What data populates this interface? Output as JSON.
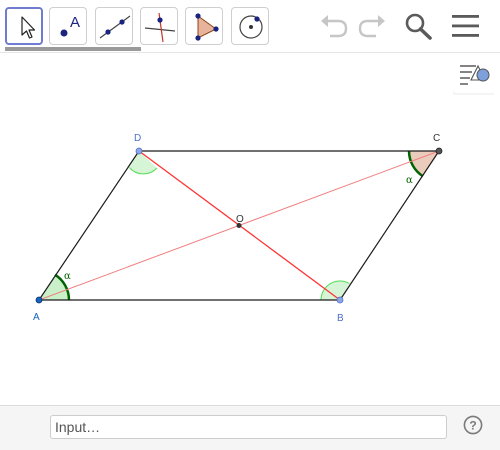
{
  "toolbar": {
    "tools": [
      {
        "name": "move-tool",
        "selected": true
      },
      {
        "name": "point-tool",
        "selected": false,
        "label": "A"
      },
      {
        "name": "line-tool",
        "selected": false
      },
      {
        "name": "perpendicular-line-tool",
        "selected": false
      },
      {
        "name": "polygon-tool",
        "selected": false
      },
      {
        "name": "circle-tool",
        "selected": false
      }
    ],
    "undo_icon": "undo-icon",
    "redo_icon": "redo-icon",
    "search_icon": "search-icon",
    "menu_icon": "hamburger-menu-icon"
  },
  "style_bar_toggle_icon": "style-bar-toggle-icon",
  "construction": {
    "points": {
      "A": {
        "label": "A",
        "color": "#1565c0"
      },
      "B": {
        "label": "B",
        "color": "#4d6ec8"
      },
      "C": {
        "label": "C",
        "color": "#333333"
      },
      "D": {
        "label": "D",
        "color": "#4d6ec8"
      },
      "O": {
        "label": "O",
        "color": "#333333"
      }
    },
    "angle_label": "α",
    "colors": {
      "edge": "#1a1a1a",
      "diagonal_bd": "#ff3333",
      "diagonal_ac": "#f08080",
      "angle_green": "#006400",
      "angle_fill_green": "#a5e6a5",
      "angle_fill_brown": "#e7c3b0"
    }
  },
  "input_bar": {
    "placeholder": "Input…",
    "value": "",
    "help_icon": "help-icon"
  }
}
